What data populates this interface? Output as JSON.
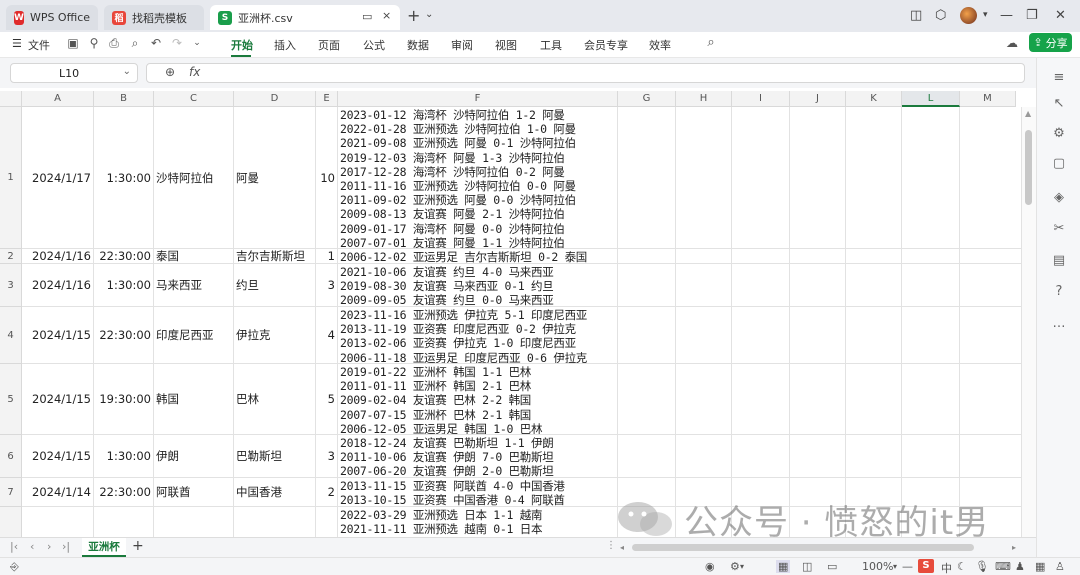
{
  "tabs": [
    {
      "label": "WPS Office",
      "icon": "wps-logo-icon"
    },
    {
      "label": "找稻壳模板",
      "icon": "docer-logo-icon"
    },
    {
      "label": "亚洲杯.csv",
      "icon": "spreadsheet-s-icon",
      "active": true
    }
  ],
  "ribbon": {
    "file_label": "文件",
    "menus": [
      "开始",
      "插入",
      "页面",
      "公式",
      "数据",
      "审阅",
      "视图",
      "工具",
      "会员专享",
      "效率"
    ],
    "active_menu": "开始",
    "share_label": "分享"
  },
  "formula_bar": {
    "name_box": "L10",
    "formula": ""
  },
  "columns": [
    "A",
    "B",
    "C",
    "D",
    "E",
    "F",
    "G",
    "H",
    "I",
    "J",
    "K",
    "L",
    "M"
  ],
  "selected_column": "L",
  "rows": [
    {
      "num": "1",
      "date": "2024/1/17",
      "time": "1:30:00",
      "home": "沙特阿拉伯",
      "away": "阿曼",
      "count": "10",
      "history": [
        "2023-01-12 海湾杯 沙特阿拉伯 1-2 阿曼",
        "2022-01-28 亚洲预选 沙特阿拉伯 1-0 阿曼",
        "2021-09-08 亚洲预选 阿曼 0-1 沙特阿拉伯",
        "2019-12-03 海湾杯 阿曼 1-3 沙特阿拉伯",
        "2017-12-28 海湾杯 沙特阿拉伯 0-2 阿曼",
        "2011-11-16 亚洲预选 沙特阿拉伯 0-0 阿曼",
        "2011-09-02 亚洲预选 阿曼 0-0 沙特阿拉伯",
        "2009-08-13 友谊赛 阿曼 2-1 沙特阿拉伯",
        "2009-01-17 海湾杯 阿曼 0-0 沙特阿拉伯",
        "2007-07-01 友谊赛 阿曼 1-1 沙特阿拉伯"
      ]
    },
    {
      "num": "2",
      "date": "2024/1/16",
      "time": "22:30:00",
      "home": "泰国",
      "away": "吉尔吉斯斯坦",
      "count": "1",
      "history": [
        "2006-12-02 亚运男足 吉尔吉斯斯坦 0-2 泰国"
      ]
    },
    {
      "num": "3",
      "date": "2024/1/16",
      "time": "1:30:00",
      "home": "马来西亚",
      "away": "约旦",
      "count": "3",
      "history": [
        "2021-10-06 友谊赛 约旦 4-0 马来西亚",
        "2019-08-30 友谊赛 马来西亚 0-1 约旦",
        "2009-09-05 友谊赛 约旦 0-0 马来西亚"
      ]
    },
    {
      "num": "4",
      "date": "2024/1/15",
      "time": "22:30:00",
      "home": "印度尼西亚",
      "away": "伊拉克",
      "count": "4",
      "history": [
        "2023-11-16 亚洲预选 伊拉克 5-1 印度尼西亚",
        "2013-11-19 亚资赛 印度尼西亚 0-2 伊拉克",
        "2013-02-06 亚资赛 伊拉克 1-0 印度尼西亚",
        "2006-11-18 亚运男足 印度尼西亚 0-6 伊拉克"
      ]
    },
    {
      "num": "5",
      "date": "2024/1/15",
      "time": "19:30:00",
      "home": "韩国",
      "away": "巴林",
      "count": "5",
      "history": [
        "2019-01-22 亚洲杯 韩国 1-1 巴林",
        "2011-01-11 亚洲杯 韩国 2-1 巴林",
        "2009-02-04 友谊赛 巴林 2-2 韩国",
        "2007-07-15 亚洲杯 巴林 2-1 韩国",
        "2006-12-05 亚运男足 韩国 1-0 巴林"
      ]
    },
    {
      "num": "6",
      "date": "2024/1/15",
      "time": "1:30:00",
      "home": "伊朗",
      "away": "巴勒斯坦",
      "count": "3",
      "history": [
        "2018-12-24 友谊赛 巴勒斯坦 1-1 伊朗",
        "2011-10-06 友谊赛 伊朗 7-0 巴勒斯坦",
        "2007-06-20 友谊赛 伊朗 2-0 巴勒斯坦"
      ]
    },
    {
      "num": "7",
      "date": "2024/1/14",
      "time": "22:30:00",
      "home": "阿联酋",
      "away": "中国香港",
      "count": "2",
      "history": [
        "2013-11-15 亚资赛 阿联酋 4-0 中国香港",
        "2013-10-15 亚资赛 中国香港 0-4 阿联酋"
      ]
    },
    {
      "num": "",
      "date": "",
      "time": "",
      "home": "",
      "away": "",
      "count": "",
      "history": [
        "2022-03-29 亚洲预选 日本 1-1 越南",
        "2021-11-11 亚洲预选 越南 0-1 日本"
      ]
    }
  ],
  "sheet": {
    "name": "亚洲杯"
  },
  "status": {
    "zoom": "100%",
    "ime_label": "中"
  },
  "watermark": "公众号 · 愤怒的it男"
}
